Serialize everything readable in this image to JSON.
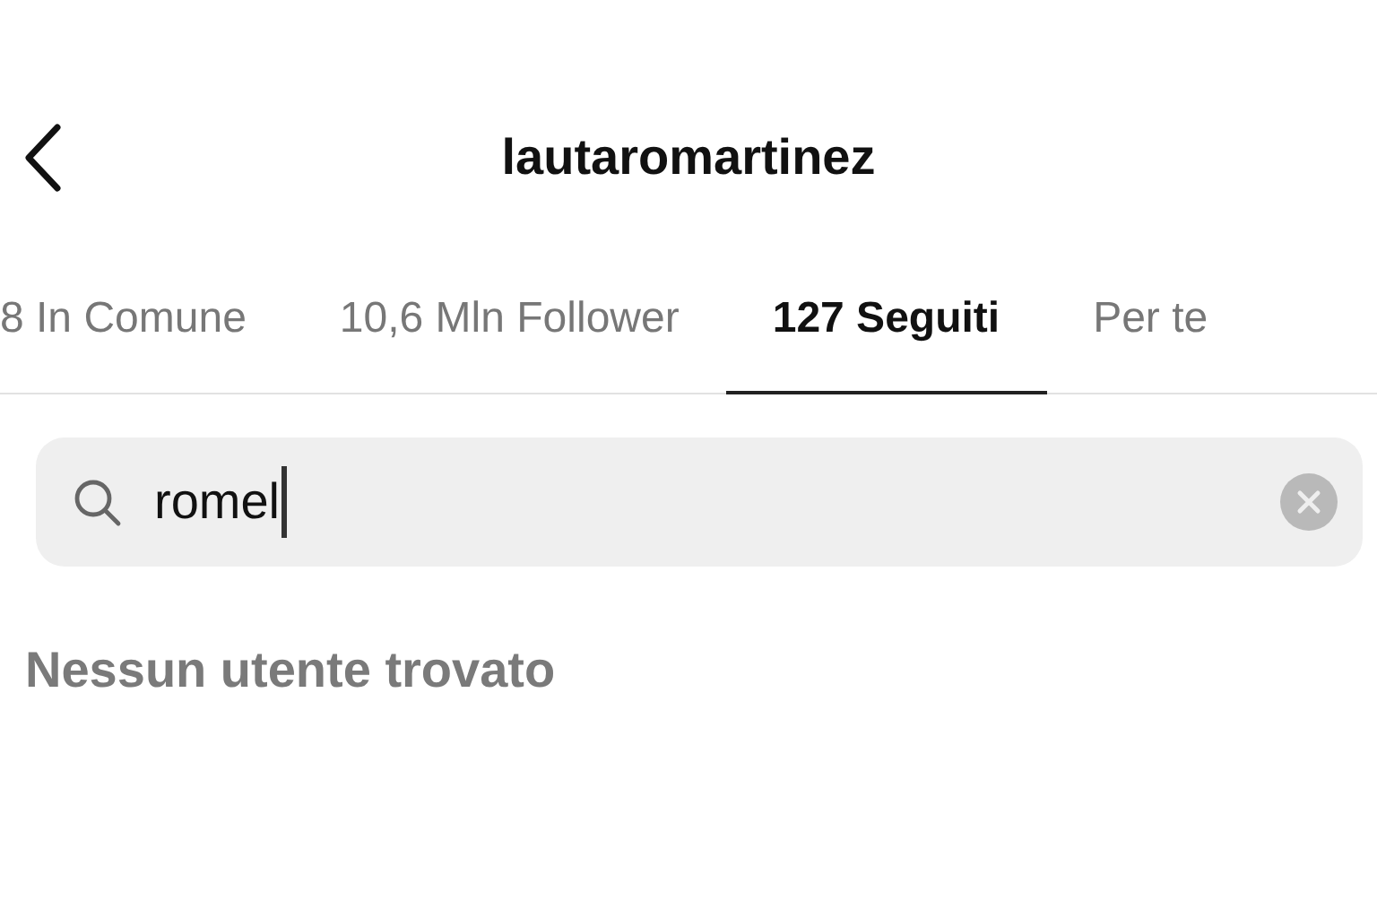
{
  "header": {
    "title": "lautaromartinez"
  },
  "tabs": [
    {
      "label": "8 In Comune",
      "selected": false
    },
    {
      "label": "10,6 Mln Follower",
      "selected": false
    },
    {
      "label": "127 Seguiti",
      "selected": true
    },
    {
      "label": "Per te",
      "selected": false
    }
  ],
  "search": {
    "value": "romel",
    "focused": true
  },
  "message": "Nessun utente trovato"
}
